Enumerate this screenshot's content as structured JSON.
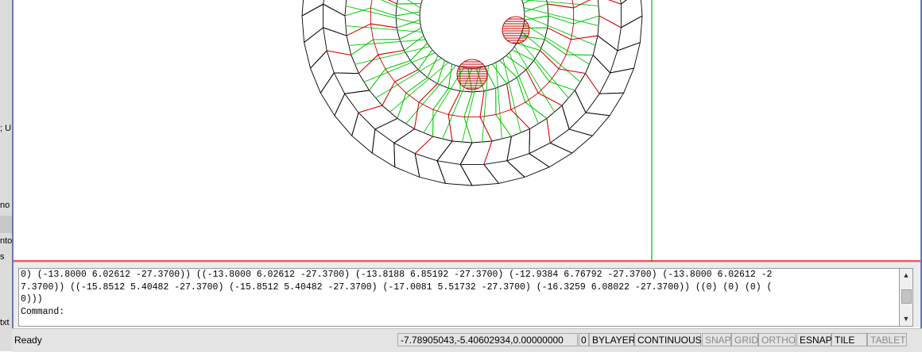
{
  "left_panel": {
    "fragments": [
      "; U",
      "no l",
      "nto",
      "s",
      "txt"
    ]
  },
  "command_window": {
    "lines": [
      "0) (-13.8000 6.02612 -27.3700)) ((-13.8000 6.02612 -27.3700) (-13.8188 6.85192 -27.3700) (-12.9384 6.76792 -27.3700) (-13.8000 6.02612 -2",
      "7.3700)) ((-15.8512 5.40482 -27.3700) (-15.8512 5.40482 -27.3700) (-17.0081 5.51732 -27.3700) (-16.3259 6.08022 -27.3700)) ((0) (0) (0) (",
      "0)))",
      "Command:"
    ],
    "scroll_up_icon": "▲",
    "scroll_down_icon": "▼"
  },
  "status_bar": {
    "status": "Ready",
    "coordinates": "-7.78905043,-5.40602934,0.00000000",
    "layer": "0",
    "color": "BYLAYER",
    "linetype": "CONTINUOUS",
    "toggles": [
      {
        "label": "SNAP",
        "on": false
      },
      {
        "label": "GRID",
        "on": false
      },
      {
        "label": "ORTHO",
        "on": false
      },
      {
        "label": "ESNAP",
        "on": true
      },
      {
        "label": "TILE",
        "on": true
      },
      {
        "label": "TABLET",
        "on": false
      }
    ]
  },
  "colors": {
    "frame": "#6a78b0",
    "mesh_black": "#000000",
    "mesh_red": "#d00000",
    "mesh_green": "#00c800",
    "axis_red": "#e00000",
    "axis_green": "#00d000"
  }
}
